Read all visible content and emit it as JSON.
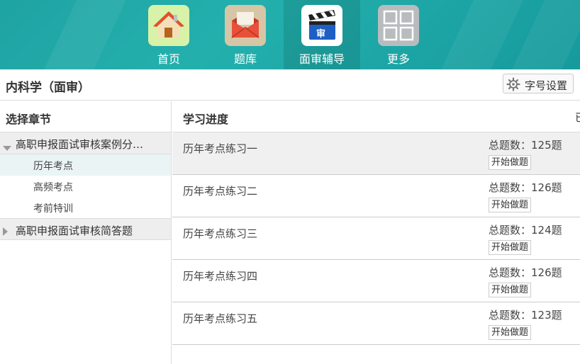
{
  "nav": {
    "items": [
      {
        "label": "首页",
        "icon": "home-icon"
      },
      {
        "label": "题库",
        "icon": "envelope-icon"
      },
      {
        "label": "面审辅导",
        "icon": "clapperboard-icon",
        "badge": "审"
      },
      {
        "label": "更多",
        "icon": "grid-icon"
      }
    ],
    "active_index": 2
  },
  "titlebar": {
    "title": "内科学（面审）",
    "font_button": "字号设置"
  },
  "sidebar": {
    "heading": "选择章节",
    "groups": [
      {
        "label": "高职申报面试审核案例分…",
        "expanded": true,
        "children": [
          "历年考点",
          "高频考点",
          "考前特训"
        ],
        "active_child": 0
      },
      {
        "label": "高职申报面试审核简答题",
        "expanded": false
      }
    ]
  },
  "main": {
    "heading": "学习进度",
    "heading_cut": "已",
    "rows": [
      {
        "name": "历年考点练习一",
        "total": "总题数：125题",
        "button": "开始做题"
      },
      {
        "name": "历年考点练习二",
        "total": "总题数：126题",
        "button": "开始做题"
      },
      {
        "name": "历年考点练习三",
        "total": "总题数：124题",
        "button": "开始做题"
      },
      {
        "name": "历年考点练习四",
        "total": "总题数：126题",
        "button": "开始做题"
      },
      {
        "name": "历年考点练习五",
        "total": "总题数：123题",
        "button": "开始做题"
      }
    ]
  },
  "colors": {
    "nav_bg": "#1fa3a3",
    "accent": "#23b0ad"
  }
}
